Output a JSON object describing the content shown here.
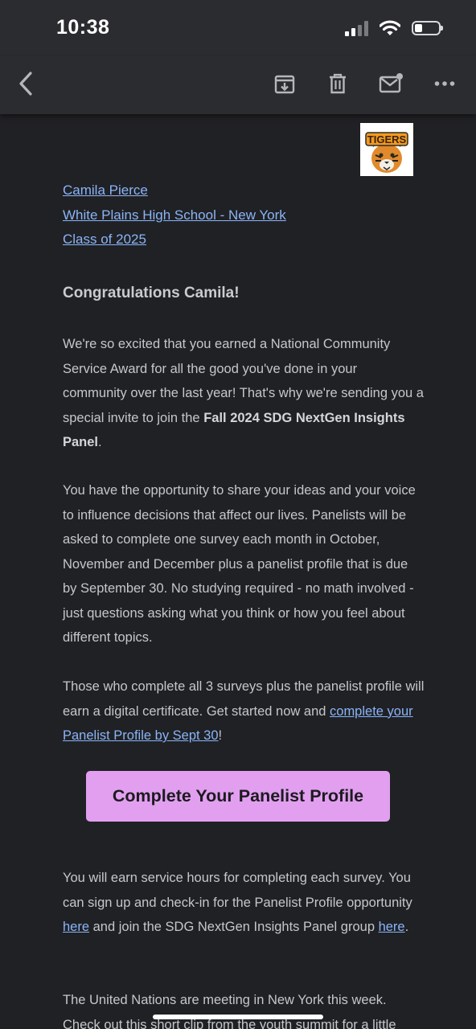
{
  "status_bar": {
    "time": "10:38"
  },
  "toolbar": {
    "back_icon": "chevron-left-icon",
    "archive_icon": "archive-icon",
    "delete_icon": "trash-icon",
    "mark_unread_icon": "mail-unread-icon",
    "more_icon": "more-horizontal-icon"
  },
  "email": {
    "logo_text": "TIGERS",
    "header_links": [
      "Camila Pierce",
      "White Plains High School - New York",
      "Class of 2025"
    ],
    "greeting": "Congratulations Camila!",
    "p1_text": "We're so excited that you earned a National Community Service Award for all the good you've done in your community over the last year! That's why we're sending you a special invite to join the ",
    "p1_bold": "Fall 2024 SDG NextGen Insights Panel",
    "p1_end": ".",
    "p2": "You have the opportunity to share your ideas and your voice to influence decisions that affect our lives. Panelists will be asked to complete one survey each month in October, November and December plus a panelist profile that is due by September 30. No studying required - no math involved - just questions asking what you think or how you feel about different topics.",
    "p3_text": "Those who complete all 3 surveys plus the panelist profile will earn a digital certificate. Get started now and ",
    "p3_link": "complete your Panelist Profile by Sept 30",
    "p3_end": "!",
    "cta_label": "Complete Your Panelist Profile",
    "p4_a": "You will earn service hours for completing each survey. You can sign up and check-in for the Panelist Profile opportunity ",
    "p4_link1": "here",
    "p4_b": " and join the SDG NextGen Insights Panel group ",
    "p4_link2": "here",
    "p4_end": ".",
    "p5": "The United Nations are meeting in New York this week. Check out this short clip from the youth summit for a little"
  },
  "colors": {
    "background": "#202124",
    "link": "#8ab4f8",
    "cta": "#e29ff0"
  }
}
